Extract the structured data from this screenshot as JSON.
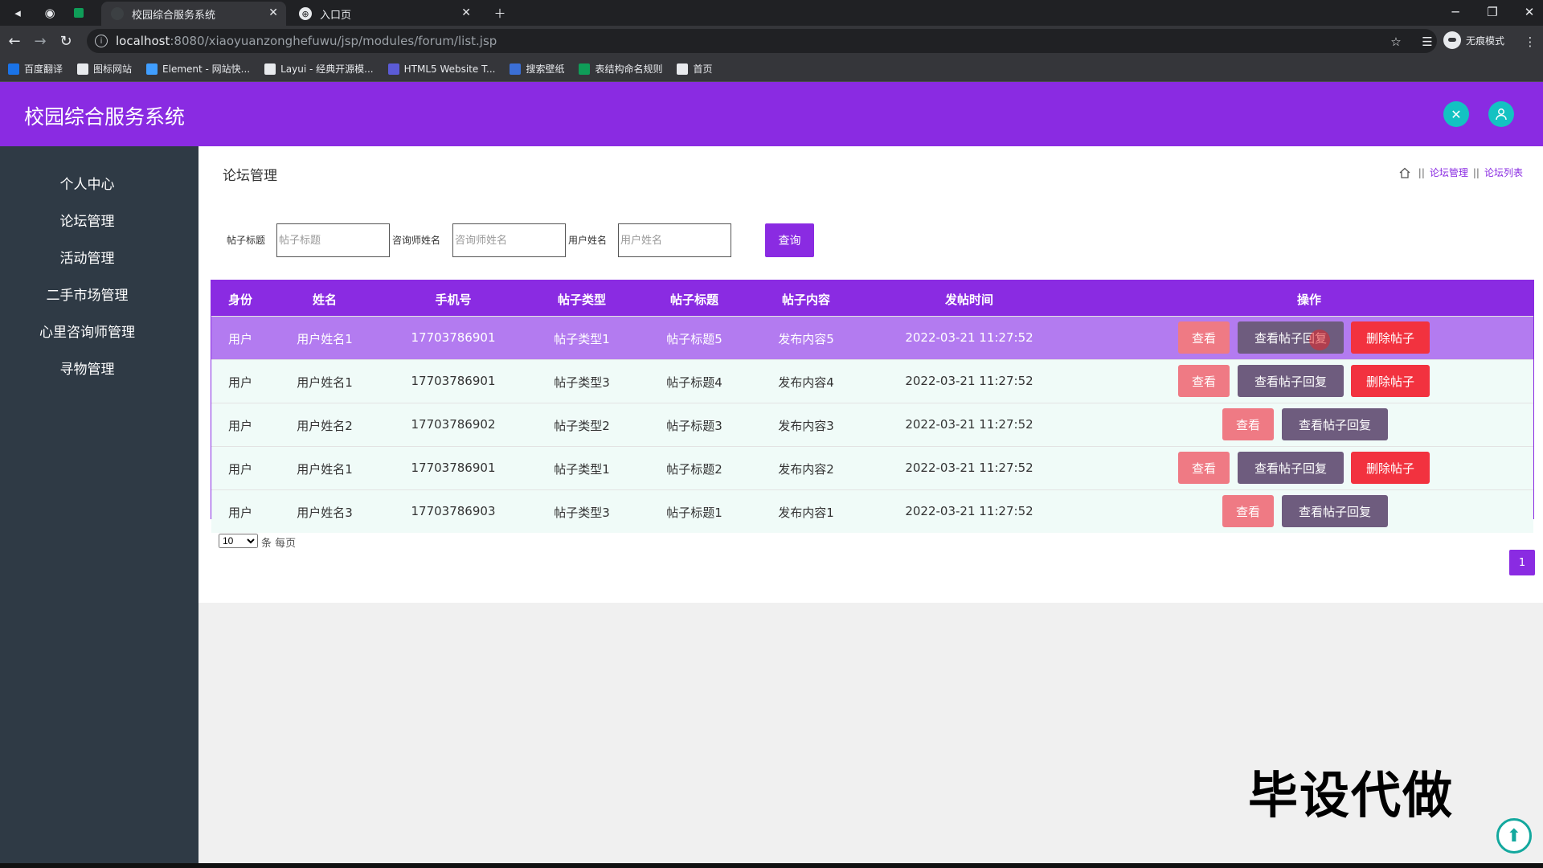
{
  "browser": {
    "tabs": [
      {
        "title": "校园综合服务系统",
        "active": true
      },
      {
        "title": "入口页",
        "active": false
      }
    ],
    "url_host": "localhost",
    "url_path": ":8080/xiaoyuanzonghefuwu/jsp/modules/forum/list.jsp",
    "profile_label": "无痕模式",
    "bookmarks": [
      {
        "label": "百度翻译",
        "color": "#1a73e8"
      },
      {
        "label": "图标网站",
        "color": "#e8eaed"
      },
      {
        "label": "Element - 网站快...",
        "color": "#409eff"
      },
      {
        "label": "Layui - 经典开源模...",
        "color": "#e8eaed"
      },
      {
        "label": "HTML5 Website T...",
        "color": "#5b5bd6"
      },
      {
        "label": "搜索壁纸",
        "color": "#3b6fd6"
      },
      {
        "label": "表结构命名规则",
        "color": "#0f9d58"
      },
      {
        "label": "首页",
        "color": "#e8eaed"
      }
    ]
  },
  "app": {
    "title": "校园综合服务系统",
    "accent": "#8a2be2",
    "sidebar": [
      "个人中心",
      "论坛管理",
      "活动管理",
      "二手市场管理",
      "心里咨询师管理",
      "寻物管理"
    ],
    "page_title": "论坛管理",
    "breadcrumb": [
      "论坛管理",
      "论坛列表"
    ],
    "search": {
      "fields": [
        {
          "label": "帖子标题",
          "placeholder": "帖子标题"
        },
        {
          "label": "咨询师姓名",
          "placeholder": "咨询师姓名"
        },
        {
          "label": "用户姓名",
          "placeholder": "用户姓名"
        }
      ],
      "button": "查询"
    },
    "table": {
      "headers": [
        "身份",
        "姓名",
        "手机号",
        "帖子类型",
        "帖子标题",
        "帖子内容",
        "发帖时间",
        "操作"
      ],
      "rows": [
        {
          "identity": "用户",
          "name": "用户姓名1",
          "phone": "17703786901",
          "type": "帖子类型1",
          "title": "帖子标题5",
          "content": "发布内容5",
          "time": "2022-03-21 11:27:52",
          "can_delete": true
        },
        {
          "identity": "用户",
          "name": "用户姓名1",
          "phone": "17703786901",
          "type": "帖子类型3",
          "title": "帖子标题4",
          "content": "发布内容4",
          "time": "2022-03-21 11:27:52",
          "can_delete": true
        },
        {
          "identity": "用户",
          "name": "用户姓名2",
          "phone": "17703786902",
          "type": "帖子类型2",
          "title": "帖子标题3",
          "content": "发布内容3",
          "time": "2022-03-21 11:27:52",
          "can_delete": false
        },
        {
          "identity": "用户",
          "name": "用户姓名1",
          "phone": "17703786901",
          "type": "帖子类型1",
          "title": "帖子标题2",
          "content": "发布内容2",
          "time": "2022-03-21 11:27:52",
          "can_delete": true
        },
        {
          "identity": "用户",
          "name": "用户姓名3",
          "phone": "17703786903",
          "type": "帖子类型3",
          "title": "帖子标题1",
          "content": "发布内容1",
          "time": "2022-03-21 11:27:52",
          "can_delete": false
        }
      ],
      "actions": {
        "view": "查看",
        "reply": "查看帖子回复",
        "delete": "删除帖子"
      }
    },
    "pagination": {
      "page_size": "10",
      "page_size_label": "条 每页",
      "current_page": "1"
    },
    "watermark": "毕设代做"
  }
}
